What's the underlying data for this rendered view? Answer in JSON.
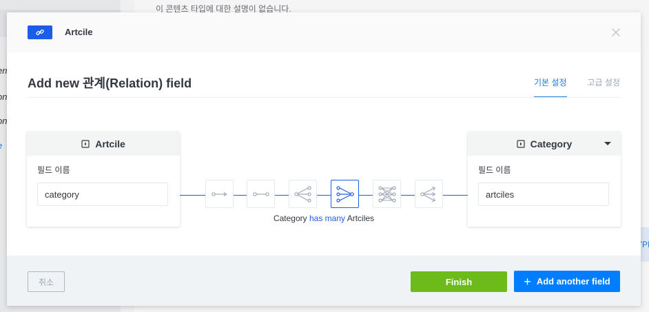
{
  "background": {
    "description_text": "이 콘텐츠 타입에 대한 설명이 없습니다.",
    "sidebar_fragments": [
      "erri",
      "on",
      "on",
      "e"
    ],
    "right_fragment": "YPI"
  },
  "modal": {
    "content_type_name": "Artcile",
    "title": "Add new 관계(Relation) field",
    "tabs": [
      {
        "label": "기본 설정",
        "active": true
      },
      {
        "label": "고급 설정",
        "active": false
      }
    ],
    "left_box": {
      "model_name": "Artcile",
      "field_label": "필드 이름",
      "field_value": "category"
    },
    "right_box": {
      "model_name": "Category",
      "field_label": "필드 이름",
      "field_value": "artciles"
    },
    "relation_types": [
      {
        "icon": "one-way-icon",
        "active": false
      },
      {
        "icon": "one-to-one-icon",
        "active": false
      },
      {
        "icon": "one-to-many-icon",
        "active": false
      },
      {
        "icon": "many-to-one-icon",
        "active": true
      },
      {
        "icon": "many-to-many-icon",
        "active": false
      },
      {
        "icon": "many-way-icon",
        "active": false
      }
    ],
    "relation_description": {
      "subject": "Category",
      "relation": "has many",
      "object": "Artciles"
    },
    "footer": {
      "cancel_label": "취소",
      "finish_label": "Finish",
      "add_another_label": "Add another field"
    },
    "colors": {
      "accent": "#1c5de7",
      "finish": "#6dbb1a",
      "add": "#007eff"
    }
  }
}
